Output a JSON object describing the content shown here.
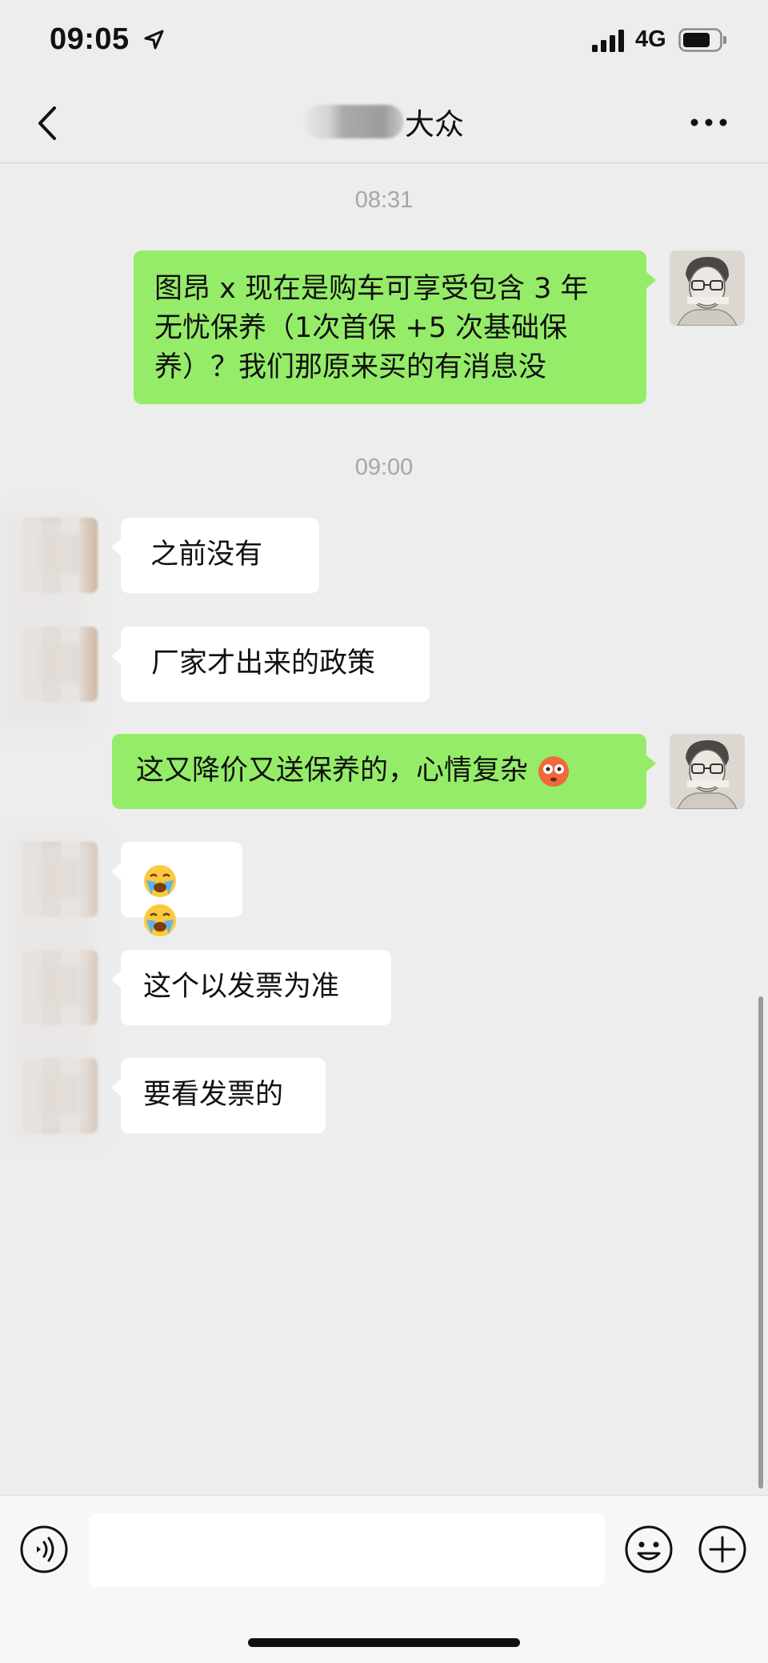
{
  "status_bar": {
    "time": "09:05",
    "network": "4G"
  },
  "nav": {
    "title": "大众",
    "back_icon": "chevron-left-icon",
    "more_icon": "more-horizontal-icon"
  },
  "chat": {
    "timestamps": [
      "08:31",
      "09:00"
    ],
    "messages": [
      {
        "side": "out",
        "text": "图昂 x 现在是购车可享受包含 3 年\n无忧保养（1次首保 +5 次基础保\n养）？我们那原来买的有消息没"
      },
      {
        "side": "in",
        "text": " 之前没有"
      },
      {
        "side": "in",
        "text": "厂家才出来的政策"
      },
      {
        "side": "out",
        "text": "这又降价又送保养的，心情复杂",
        "emoji": "flushed-face-emoji"
      },
      {
        "side": "in",
        "emoji": "loudly-crying-face-emoji x2"
      },
      {
        "side": "in",
        "text": "这个以发票为准"
      },
      {
        "side": "in",
        "text": "要看发票的"
      }
    ]
  },
  "input_bar": {
    "message_value": "",
    "voice_icon": "voice-icon",
    "emoji_icon": "emoji-icon",
    "plus_icon": "plus-icon"
  },
  "colors": {
    "background": "#ededed",
    "outgoing_bubble": "#95ec69",
    "incoming_bubble": "#ffffff",
    "timestamp": "#a6a6a6"
  }
}
